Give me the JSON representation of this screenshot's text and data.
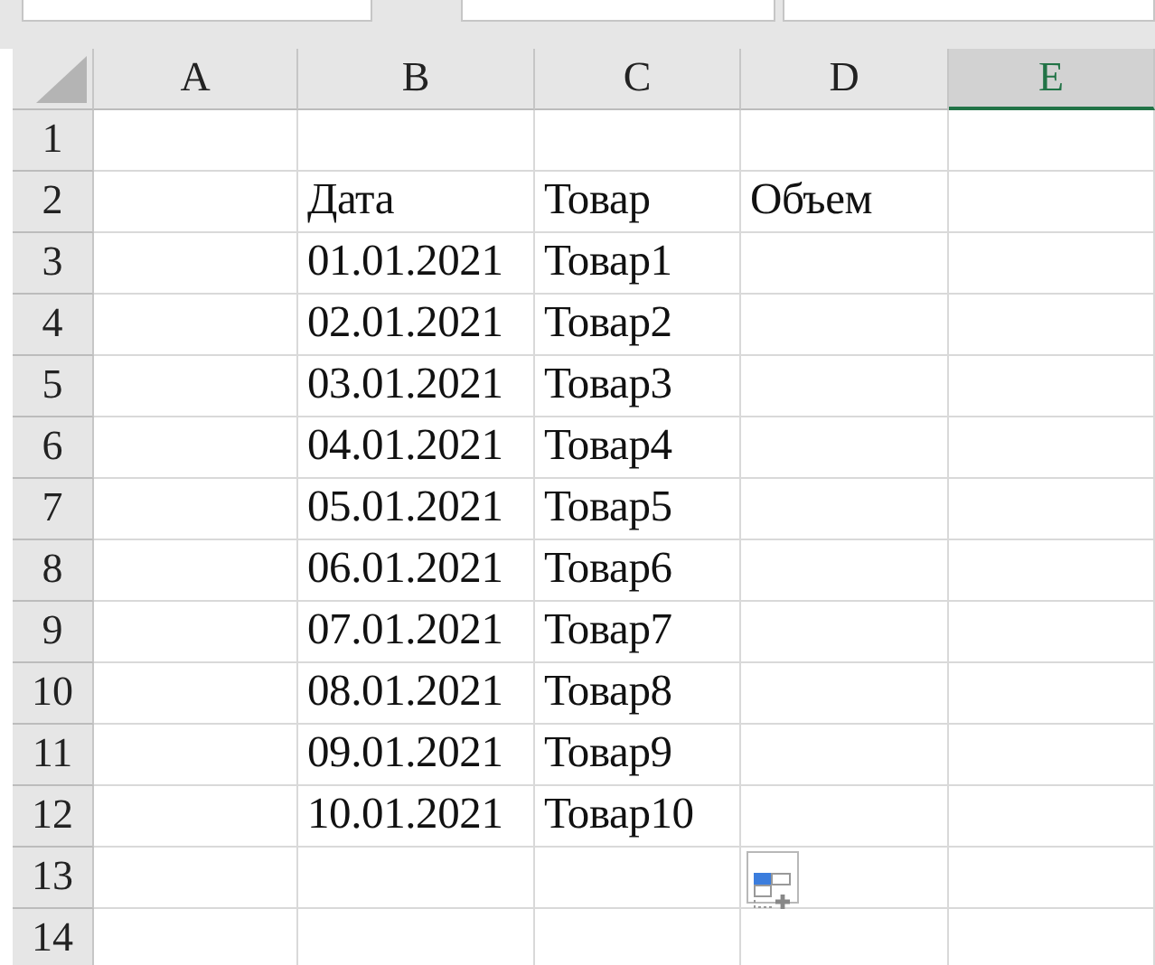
{
  "columns": [
    {
      "label": "A",
      "selected": false
    },
    {
      "label": "B",
      "selected": false
    },
    {
      "label": "C",
      "selected": false
    },
    {
      "label": "D",
      "selected": false
    },
    {
      "label": "E",
      "selected": true
    }
  ],
  "rows": [
    {
      "number": "1",
      "cells": [
        null,
        null,
        null,
        null,
        null
      ]
    },
    {
      "number": "2",
      "cells": [
        null,
        "Дата",
        "Товар",
        "Объем",
        null
      ]
    },
    {
      "number": "3",
      "cells": [
        null,
        "01.01.2021",
        "Товар1",
        null,
        null
      ]
    },
    {
      "number": "4",
      "cells": [
        null,
        "02.01.2021",
        "Товар2",
        null,
        null
      ]
    },
    {
      "number": "5",
      "cells": [
        null,
        "03.01.2021",
        "Товар3",
        null,
        null
      ]
    },
    {
      "number": "6",
      "cells": [
        null,
        "04.01.2021",
        "Товар4",
        null,
        null
      ]
    },
    {
      "number": "7",
      "cells": [
        null,
        "05.01.2021",
        "Товар5",
        null,
        null
      ]
    },
    {
      "number": "8",
      "cells": [
        null,
        "06.01.2021",
        "Товар6",
        null,
        null
      ]
    },
    {
      "number": "9",
      "cells": [
        null,
        "07.01.2021",
        "Товар7",
        null,
        null
      ]
    },
    {
      "number": "10",
      "cells": [
        null,
        "08.01.2021",
        "Товар8",
        null,
        null
      ]
    },
    {
      "number": "11",
      "cells": [
        null,
        "09.01.2021",
        "Товар9",
        null,
        null
      ]
    },
    {
      "number": "12",
      "cells": [
        null,
        "10.01.2021",
        "Товар10",
        null,
        null
      ]
    },
    {
      "number": "13",
      "cells": [
        null,
        null,
        null,
        null,
        null
      ]
    },
    {
      "number": "14",
      "cells": [
        null,
        null,
        null,
        null,
        null
      ]
    }
  ]
}
